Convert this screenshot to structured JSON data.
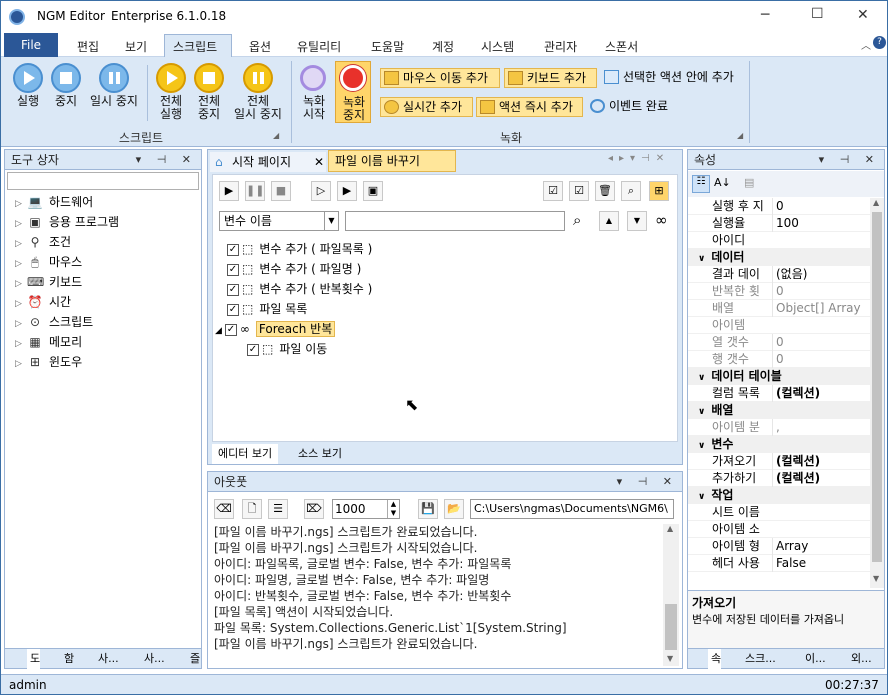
{
  "app": {
    "title": "NGM Editor",
    "edition": "Enterprise 6.1.0.18"
  },
  "window_controls": {
    "minimize": "─",
    "maximize": "☐",
    "close": "✕"
  },
  "menu": {
    "file": "File",
    "items": [
      "편집",
      "보기",
      "스크립트",
      "옵션",
      "유틸리티",
      "도움말",
      "계정",
      "시스템",
      "관리자",
      "스폰서"
    ],
    "active": "스크립트"
  },
  "ribbon": {
    "script_group": {
      "label": "스크립트",
      "buttons": [
        {
          "label1": "실행",
          "label2": "",
          "icon": "play-icon"
        },
        {
          "label1": "중지",
          "label2": "",
          "icon": "stop-icon"
        },
        {
          "label1": "일시 중지",
          "label2": "",
          "icon": "pause-icon"
        },
        {
          "label1": "전체",
          "label2": "실행",
          "icon": "play-all-icon"
        },
        {
          "label1": "전체",
          "label2": "중지",
          "icon": "stop-all-icon"
        },
        {
          "label1": "전체",
          "label2": "일시 중지",
          "icon": "pause-all-icon"
        }
      ]
    },
    "record_group": {
      "label": "녹화",
      "start": {
        "label1": "녹화",
        "label2": "시작"
      },
      "stop": {
        "label1": "녹화",
        "label2": "중지"
      },
      "small": [
        {
          "label": "마우스 이동 추가",
          "icon": "mouse-move-icon"
        },
        {
          "label": "키보드 추가",
          "icon": "keyboard-icon"
        },
        {
          "label": "선택한 액션 안에 추가",
          "icon": "nested-icon"
        },
        {
          "label": "실시간 추가",
          "icon": "clock-icon"
        },
        {
          "label": "액션 즉시 추가",
          "icon": "action-icon"
        },
        {
          "label": "이벤트 완료",
          "icon": "event-icon"
        }
      ]
    }
  },
  "toolbox": {
    "title": "도구 상자",
    "items": [
      {
        "label": "하드웨어",
        "icon": "hardware-icon",
        "glyph": "💻"
      },
      {
        "label": "응용 프로그램",
        "icon": "application-icon",
        "glyph": "▣"
      },
      {
        "label": "조건",
        "icon": "condition-icon",
        "glyph": "⚲"
      },
      {
        "label": "마우스",
        "icon": "mouse-icon",
        "glyph": "🖱"
      },
      {
        "label": "키보드",
        "icon": "keyboard-icon",
        "glyph": "⌨"
      },
      {
        "label": "시간",
        "icon": "alarm-icon",
        "glyph": "⏰"
      },
      {
        "label": "스크립트",
        "icon": "script-icon",
        "glyph": "⊙"
      },
      {
        "label": "메모리",
        "icon": "memory-icon",
        "glyph": "▦"
      },
      {
        "label": "윈도우",
        "icon": "windows-icon",
        "glyph": "⊞"
      }
    ],
    "bottom_tabs": [
      "도",
      "함",
      "사...",
      "사...",
      "즐"
    ]
  },
  "editor": {
    "tabs": [
      {
        "label": "시작 페이지",
        "active": false
      },
      {
        "label": "파일 이름 바꾸기",
        "active": true
      }
    ],
    "filter_select": "변수 이름",
    "filter_input": "",
    "actions": [
      {
        "label": "변수 추가 ( 파일목록 )",
        "level": 0
      },
      {
        "label": "변수 추가 ( 파일명 )",
        "level": 0
      },
      {
        "label": "변수 추가 ( 반복횟수 )",
        "level": 0
      },
      {
        "label": "파일 목록",
        "level": 0
      },
      {
        "label": "Foreach 반복",
        "level": 0
      },
      {
        "label": "파일 이동",
        "level": 1
      }
    ],
    "view_tabs": [
      "에디터 보기",
      "소스 보기"
    ]
  },
  "output": {
    "title": "아웃풋",
    "limit": "1000",
    "path": "C:\\Users\\ngmas\\Documents\\NGM6\\",
    "lines": [
      "[파일 이름 바꾸기.ngs] 스크립트가 완료되었습니다.",
      "[파일 이름 바꾸기.ngs] 스크립트가 시작되었습니다.",
      "아이디: 파일목록, 글로벌 변수: False, 변수 추가: 파일목록",
      "아이디: 파일명, 글로벌 변수: False, 변수 추가: 파일명",
      "아이디: 반복횟수, 글로벌 변수: False, 변수 추가: 반복횟수",
      "[파일 목록] 액션이 시작되었습니다.",
      "파일 목록: System.Collections.Generic.List`1[System.String]",
      "[파일 이름 바꾸기.ngs] 스크립트가 완료되었습니다."
    ]
  },
  "properties": {
    "title": "속성",
    "rows": [
      {
        "type": "row",
        "name": "실행 후 지",
        "value": "0"
      },
      {
        "type": "row",
        "name": "실행율",
        "value": "100"
      },
      {
        "type": "row",
        "name": "아이디",
        "value": ""
      },
      {
        "type": "cat",
        "name": "데이터"
      },
      {
        "type": "row",
        "name": "결과 데이",
        "value": "(없음)"
      },
      {
        "type": "row",
        "name": "반복한 횟",
        "value": "0",
        "grey": true
      },
      {
        "type": "row",
        "name": "배열",
        "value": "Object[] Array",
        "grey": true
      },
      {
        "type": "row",
        "name": "아이템",
        "value": "",
        "grey": true
      },
      {
        "type": "row",
        "name": "열 갯수",
        "value": "0",
        "grey": true
      },
      {
        "type": "row",
        "name": "행 갯수",
        "value": "0",
        "grey": true
      },
      {
        "type": "cat",
        "name": "데이터 테이블"
      },
      {
        "type": "row",
        "name": "컬럼 목록",
        "value": "(컬렉션)",
        "bold": true
      },
      {
        "type": "cat",
        "name": "배열"
      },
      {
        "type": "row",
        "name": "아이템 분",
        "value": ",",
        "grey": true
      },
      {
        "type": "cat",
        "name": "변수"
      },
      {
        "type": "row",
        "name": "가져오기",
        "value": "(컬렉션)",
        "bold": true
      },
      {
        "type": "row",
        "name": "추가하기",
        "value": "(컬렉션)",
        "bold": true
      },
      {
        "type": "cat",
        "name": "작업"
      },
      {
        "type": "row",
        "name": "시트 이름",
        "value": ""
      },
      {
        "type": "row",
        "name": "아이템 소",
        "value": ""
      },
      {
        "type": "row",
        "name": "아이템 형",
        "value": "Array"
      },
      {
        "type": "row",
        "name": "헤더 사용",
        "value": "False"
      }
    ],
    "desc_title": "가져오기",
    "desc_text": "변수에 저장된 데이터를 가져옵니",
    "bottom_tabs": [
      "속",
      "스크...",
      "이...",
      "외..."
    ]
  },
  "status": {
    "user": "admin",
    "time": "00:27:37"
  },
  "colors": {
    "accent": "#2b5797",
    "ribbon": "#dbe8f6",
    "highlight": "#ffe69a"
  }
}
